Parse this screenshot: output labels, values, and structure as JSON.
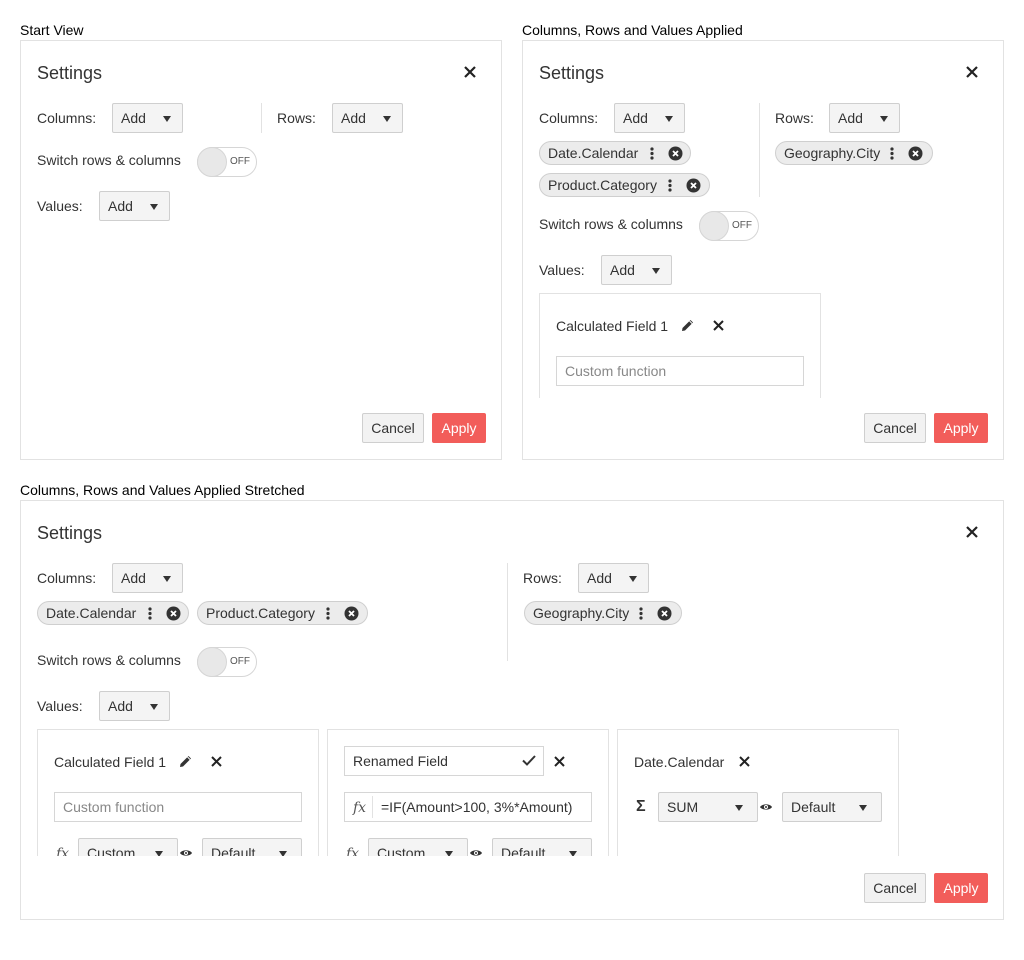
{
  "captions": {
    "start": "Start View",
    "applied": "Columns, Rows and Values Applied",
    "stretched": "Columns, Rows and Values Applied Stretched"
  },
  "common": {
    "title": "Settings",
    "columns_label": "Columns:",
    "rows_label": "Rows:",
    "values_label": "Values:",
    "switch_label": "Switch rows & columns",
    "toggle_state": "OFF",
    "add": "Add",
    "cancel": "Cancel",
    "apply": "Apply"
  },
  "chips": {
    "columns": [
      "Date.Calendar",
      "Product.Category"
    ],
    "rows": [
      "Geography.City"
    ]
  },
  "cards": {
    "calc_field_name": "Calculated Field 1",
    "custom_function_placeholder": "Custom function",
    "renamed_field_value": "Renamed Field",
    "formula_value": "=IF(Amount>100, 3%*Amount)",
    "aggregation_custom": "Custom",
    "display_default": "Default",
    "date_field_name": "Date.Calendar",
    "aggregation_sum": "SUM"
  },
  "colors": {
    "apply": "#f25d5a",
    "border": "#e2e2e2",
    "chip": "#ececec"
  }
}
